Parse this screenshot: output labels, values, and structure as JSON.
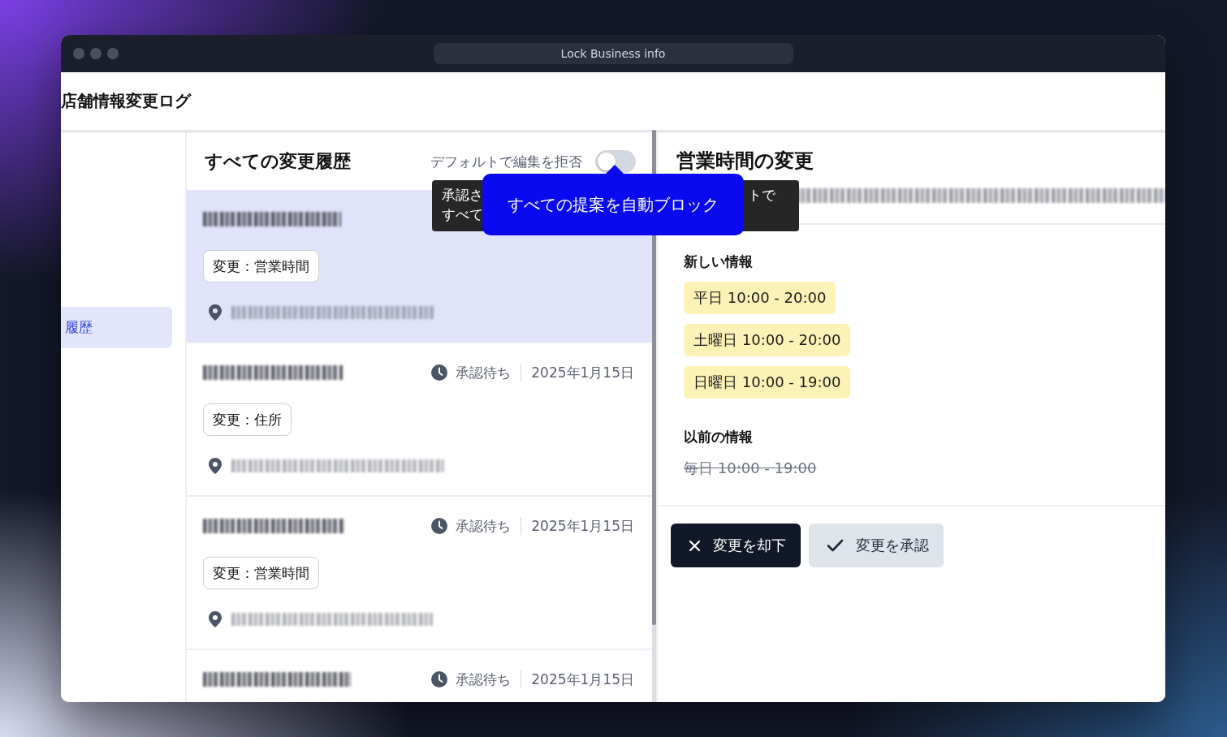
{
  "window": {
    "title": "Lock Business info"
  },
  "header": {
    "title": "店舗情報変更ログ"
  },
  "sidebar": {
    "items": [
      {
        "label": "履歴",
        "selected": true
      }
    ]
  },
  "change_list": {
    "title": "すべての変更履歴",
    "reject_by_default": {
      "label": "デフォルトで編集を拒否",
      "on": false
    },
    "items": [
      {
        "selected": true,
        "name_blurred": true,
        "tag": "変更：営業時間",
        "address_blurred": true
      },
      {
        "selected": false,
        "name_blurred": true,
        "status": "承認待ち",
        "date": "2025年1月15日",
        "tag": "変更：住所",
        "address_blurred": true
      },
      {
        "selected": false,
        "name_blurred": true,
        "status": "承認待ち",
        "date": "2025年1月15日",
        "tag": "変更：営業時間",
        "address_blurred": true
      },
      {
        "selected": false,
        "name_blurred": true,
        "status": "承認待ち",
        "date": "2025年1月15日"
      }
    ]
  },
  "tooltip": {
    "lines": [
      "承認さ",
      "すべて"
    ],
    "fragment": "トで"
  },
  "popover": {
    "text": "すべての提案を自動ブロック"
  },
  "detail": {
    "title": "営業時間の変更",
    "subtitle_blurred": true,
    "new_info": {
      "heading": "新しい情報",
      "values": [
        "平日 10:00 - 20:00",
        "土曜日 10:00 - 20:00",
        "日曜日 10:00 - 19:00"
      ]
    },
    "previous_info": {
      "heading": "以前の情報",
      "values": [
        "毎日 10:00 - 19:00"
      ]
    },
    "actions": [
      {
        "kind": "reject",
        "label": "変更を却下"
      },
      {
        "kind": "approve",
        "label": "変更を承認"
      }
    ]
  }
}
